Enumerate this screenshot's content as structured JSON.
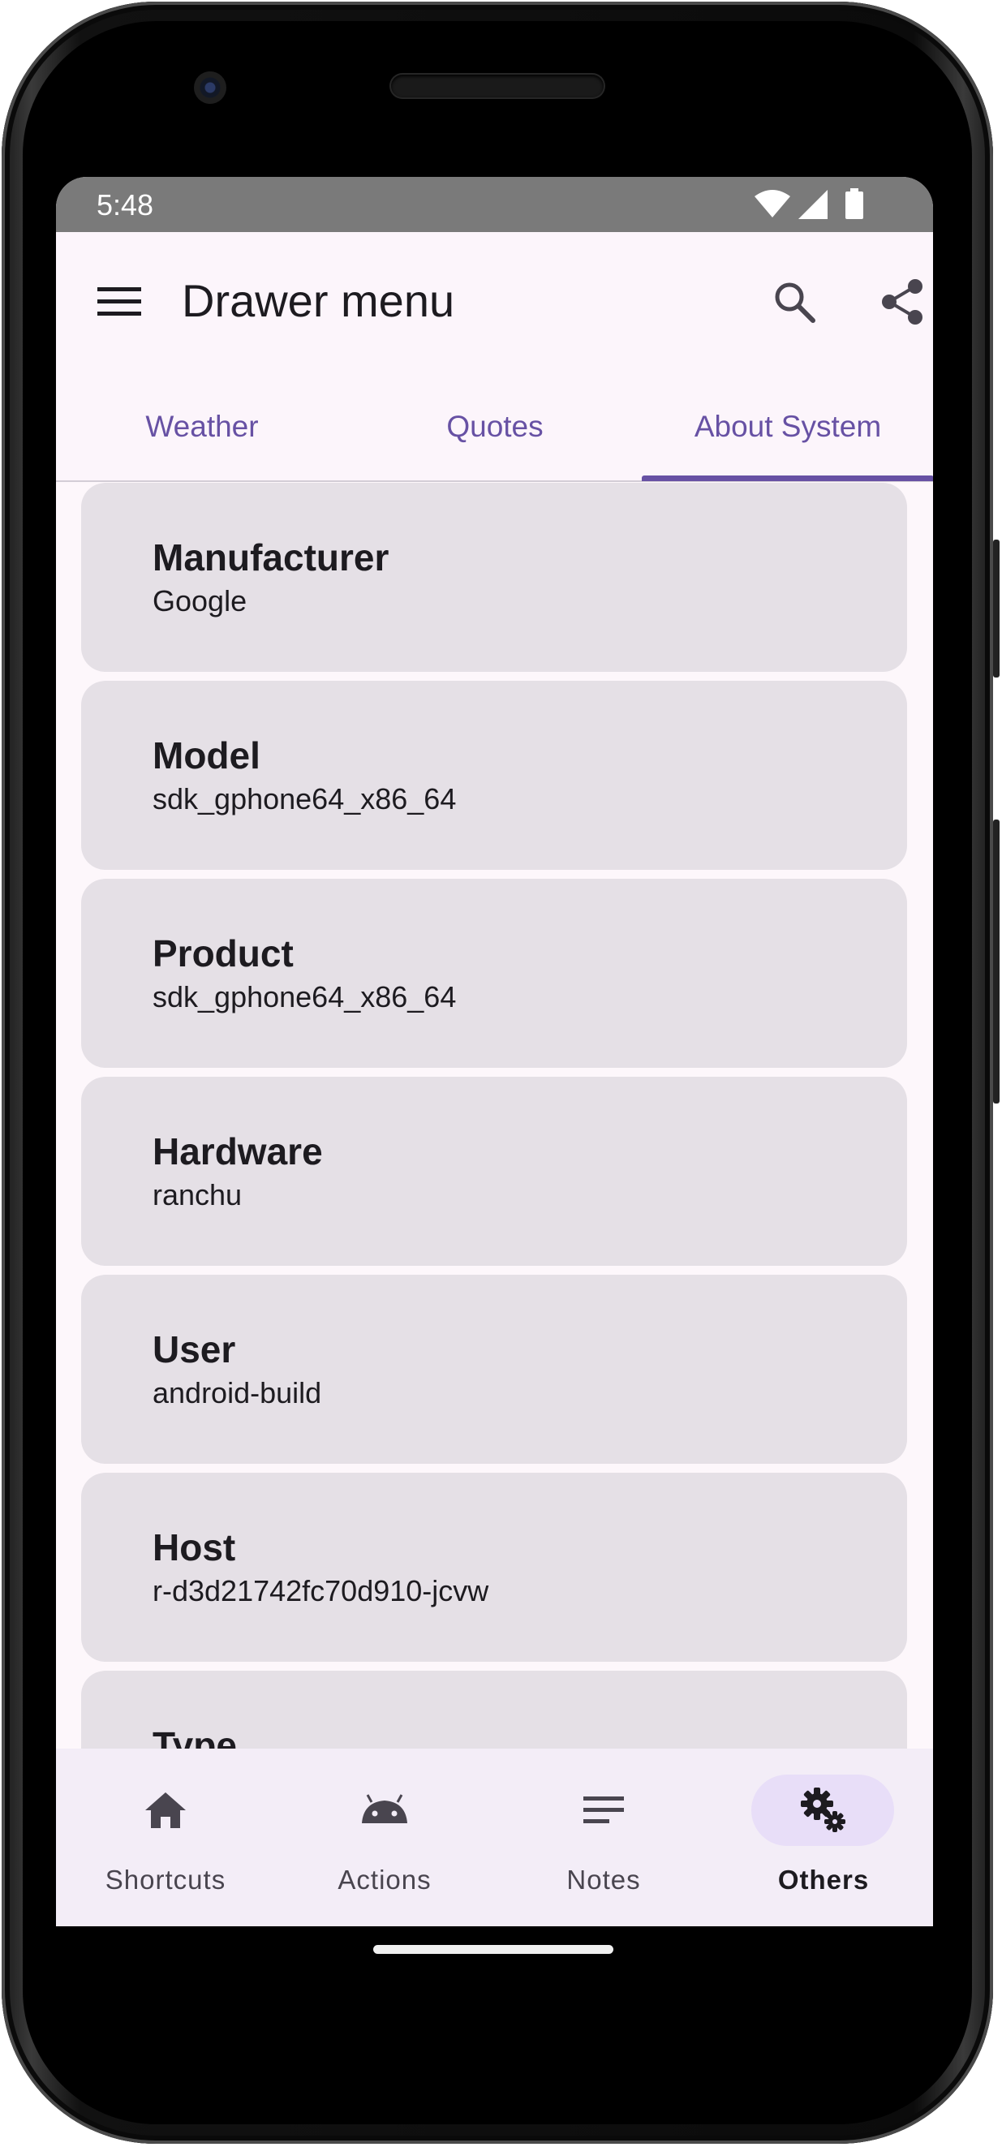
{
  "status_bar": {
    "time": "5:48",
    "wifi_icon": "wifi-icon",
    "signal_icon": "cell-signal-icon",
    "battery_icon": "battery-icon"
  },
  "app_bar": {
    "title": "Drawer menu",
    "menu_icon": "hamburger-menu-icon",
    "search_icon": "search-icon",
    "share_icon": "share-icon"
  },
  "tabs": [
    {
      "label": "Weather",
      "selected": false
    },
    {
      "label": "Quotes",
      "selected": false
    },
    {
      "label": "About System",
      "selected": true
    }
  ],
  "system_info": [
    {
      "title": "Manufacturer",
      "value": "Google"
    },
    {
      "title": "Model",
      "value": "sdk_gphone64_x86_64"
    },
    {
      "title": "Product",
      "value": "sdk_gphone64_x86_64"
    },
    {
      "title": "Hardware",
      "value": "ranchu"
    },
    {
      "title": "User",
      "value": "android-build"
    },
    {
      "title": "Host",
      "value": "r-d3d21742fc70d910-jcvw"
    },
    {
      "title": "Type",
      "value": ""
    }
  ],
  "bottom_nav": [
    {
      "label": "Shortcuts",
      "icon": "home-icon",
      "selected": false
    },
    {
      "label": "Actions",
      "icon": "android-icon",
      "selected": false
    },
    {
      "label": "Notes",
      "icon": "notes-icon",
      "selected": false
    },
    {
      "label": "Others",
      "icon": "gears-icon",
      "selected": true
    }
  ],
  "colors": {
    "accent": "#6751a4",
    "card": "#e5e0e6",
    "surface": "#fdf7fb",
    "nav_bg": "#f3edf7",
    "nav_active_pill": "#e8def8"
  }
}
